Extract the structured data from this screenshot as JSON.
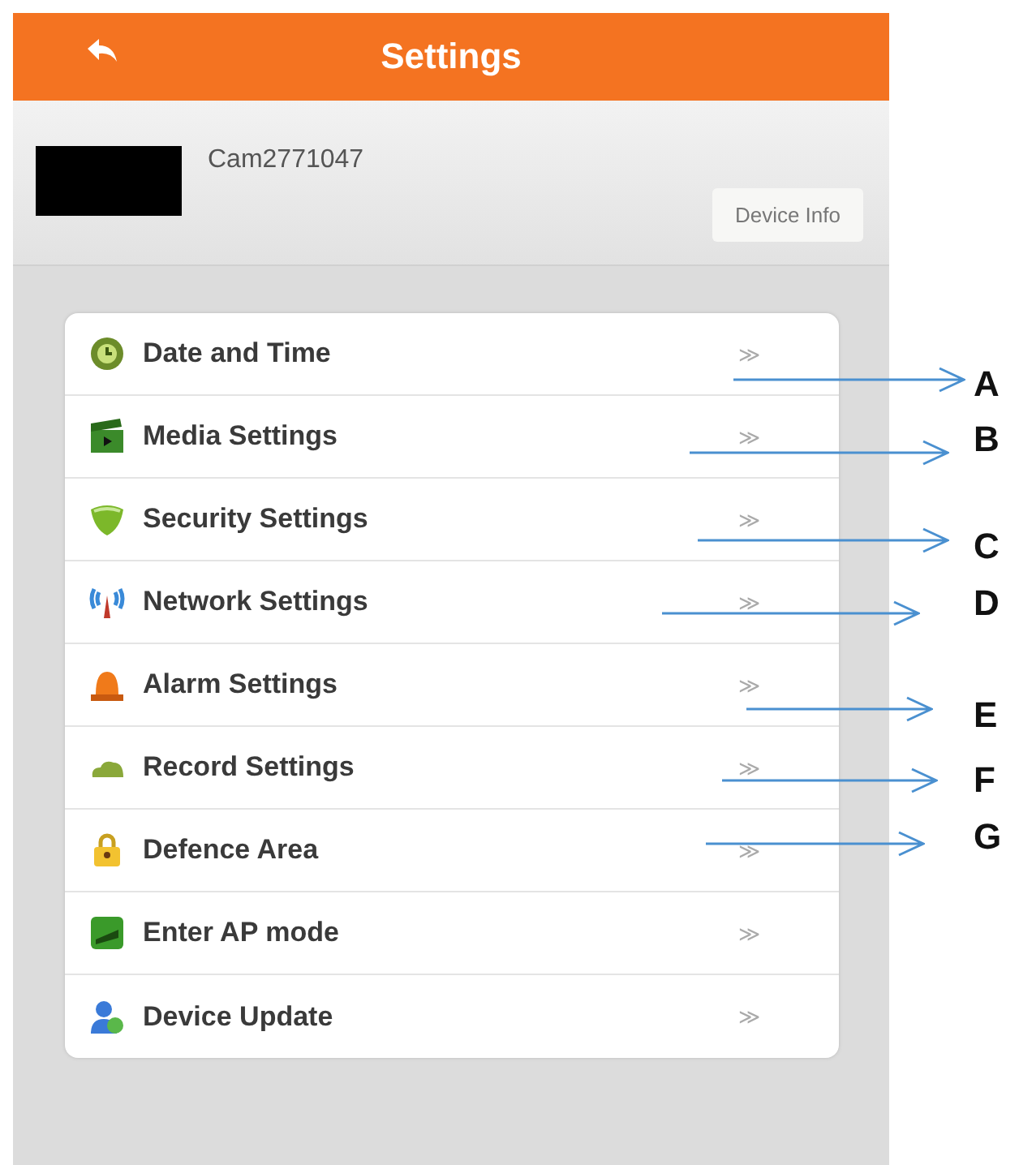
{
  "header": {
    "title": "Settings"
  },
  "device": {
    "name": "Cam2771047",
    "button": "Device Info"
  },
  "menu": [
    {
      "label": "Date and Time",
      "chevron": "≫"
    },
    {
      "label": "Media Settings",
      "chevron": "≫"
    },
    {
      "label": "Security Settings",
      "chevron": "≫"
    },
    {
      "label": "Network Settings",
      "chevron": "≫"
    },
    {
      "label": "Alarm Settings",
      "chevron": "≫"
    },
    {
      "label": "Record Settings",
      "chevron": "≫"
    },
    {
      "label": "Defence Area",
      "chevron": "≫"
    },
    {
      "label": "Enter AP mode",
      "chevron": "≫"
    },
    {
      "label": "Device Update",
      "chevron": "≫"
    }
  ],
  "annotations": [
    {
      "label": "A"
    },
    {
      "label": "B"
    },
    {
      "label": "C"
    },
    {
      "label": "D"
    },
    {
      "label": "E"
    },
    {
      "label": "F"
    },
    {
      "label": "G"
    }
  ]
}
